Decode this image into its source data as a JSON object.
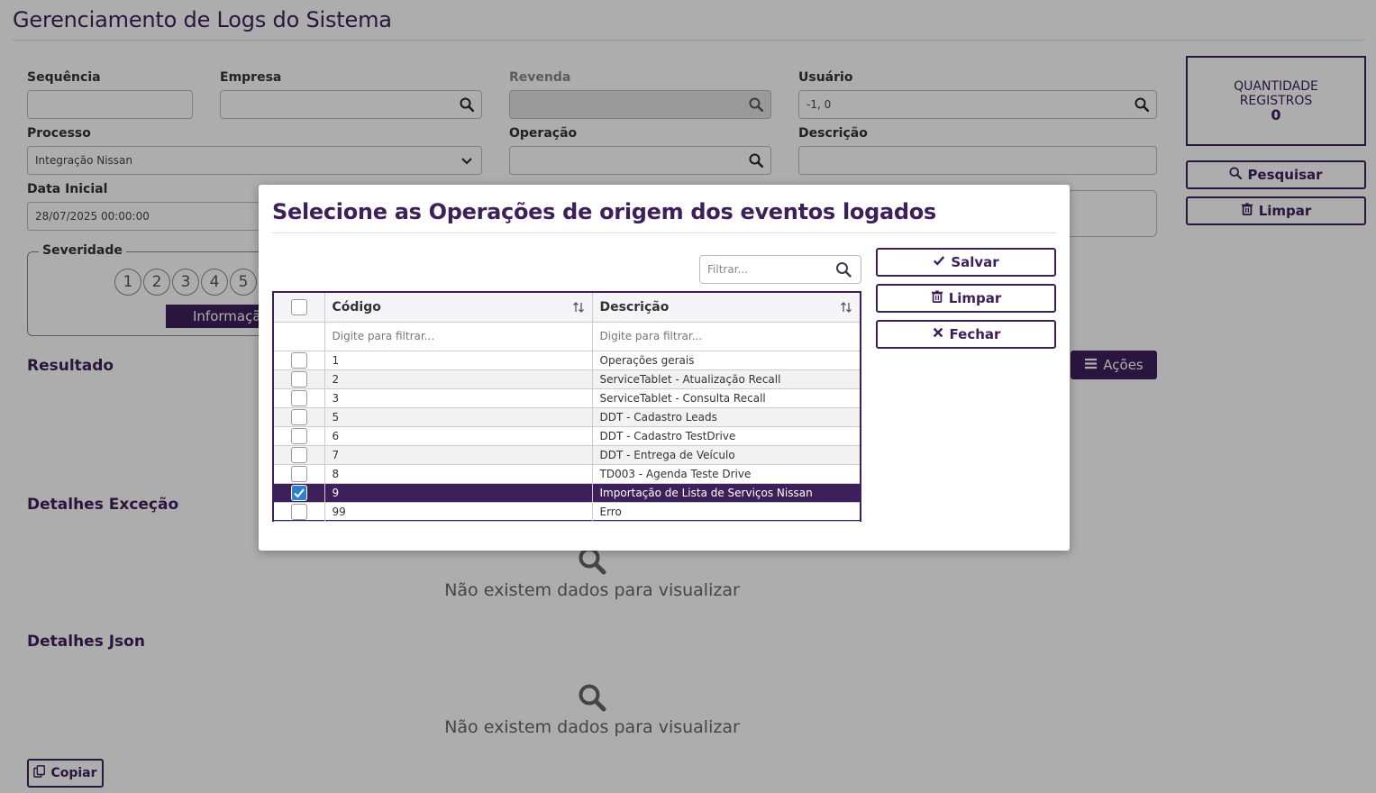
{
  "page": {
    "title": "Gerenciamento de Logs do Sistema"
  },
  "form": {
    "sequencia": {
      "label": "Sequência",
      "value": ""
    },
    "empresa": {
      "label": "Empresa",
      "value": ""
    },
    "revenda": {
      "label": "Revenda",
      "value": ""
    },
    "usuario": {
      "label": "Usuário",
      "value": "-1, 0"
    },
    "processo": {
      "label": "Processo",
      "value": "Integração Nissan"
    },
    "operacao": {
      "label": "Operação",
      "value": ""
    },
    "descricao": {
      "label": "Descrição",
      "value": ""
    },
    "data_inicial": {
      "label": "Data Inicial",
      "value": "28/07/2025 00:00:00"
    },
    "severidade": {
      "label": "Severidade",
      "levels": [
        "1",
        "2",
        "3",
        "4",
        "5"
      ],
      "selected_label": "Informaçã"
    }
  },
  "side": {
    "quantidade_label_1": "QUANTIDADE",
    "quantidade_label_2": "REGISTROS",
    "quantidade_value": "0",
    "pesquisar_label": "Pesquisar",
    "limpar_label": "Limpar"
  },
  "sections": {
    "resultado": "Resultado",
    "acoes_label": "Ações",
    "detalhes_excecao": "Detalhes Exceção",
    "detalhes_json": "Detalhes Json",
    "empty_text": "Não existem dados para visualizar",
    "copiar_label": "Copiar"
  },
  "modal": {
    "title": "Selecione as Operações de origem dos eventos logados",
    "filter_placeholder": "Filtrar...",
    "columns": {
      "codigo": "Código",
      "descricao": "Descrição"
    },
    "column_filter_placeholder": "Digite para filtrar...",
    "rows": [
      {
        "codigo": "1",
        "descricao": "Operações gerais",
        "checked": false
      },
      {
        "codigo": "2",
        "descricao": "ServiceTablet - Atualização Recall",
        "checked": false
      },
      {
        "codigo": "3",
        "descricao": "ServiceTablet - Consulta Recall",
        "checked": false
      },
      {
        "codigo": "5",
        "descricao": "DDT - Cadastro Leads",
        "checked": false
      },
      {
        "codigo": "6",
        "descricao": "DDT - Cadastro TestDrive",
        "checked": false
      },
      {
        "codigo": "7",
        "descricao": "DDT - Entrega de Veículo",
        "checked": false
      },
      {
        "codigo": "8",
        "descricao": "TD003 - Agenda Teste Drive",
        "checked": false
      },
      {
        "codigo": "9",
        "descricao": "Importação de Lista de Serviços Nissan",
        "checked": true
      },
      {
        "codigo": "99",
        "descricao": "Erro",
        "checked": false
      }
    ],
    "salvar_label": "Salvar",
    "limpar_label": "Limpar",
    "fechar_label": "Fechar"
  },
  "colors": {
    "brand": "#3d1f5a",
    "checkbox_checked": "#2f7fd0"
  }
}
